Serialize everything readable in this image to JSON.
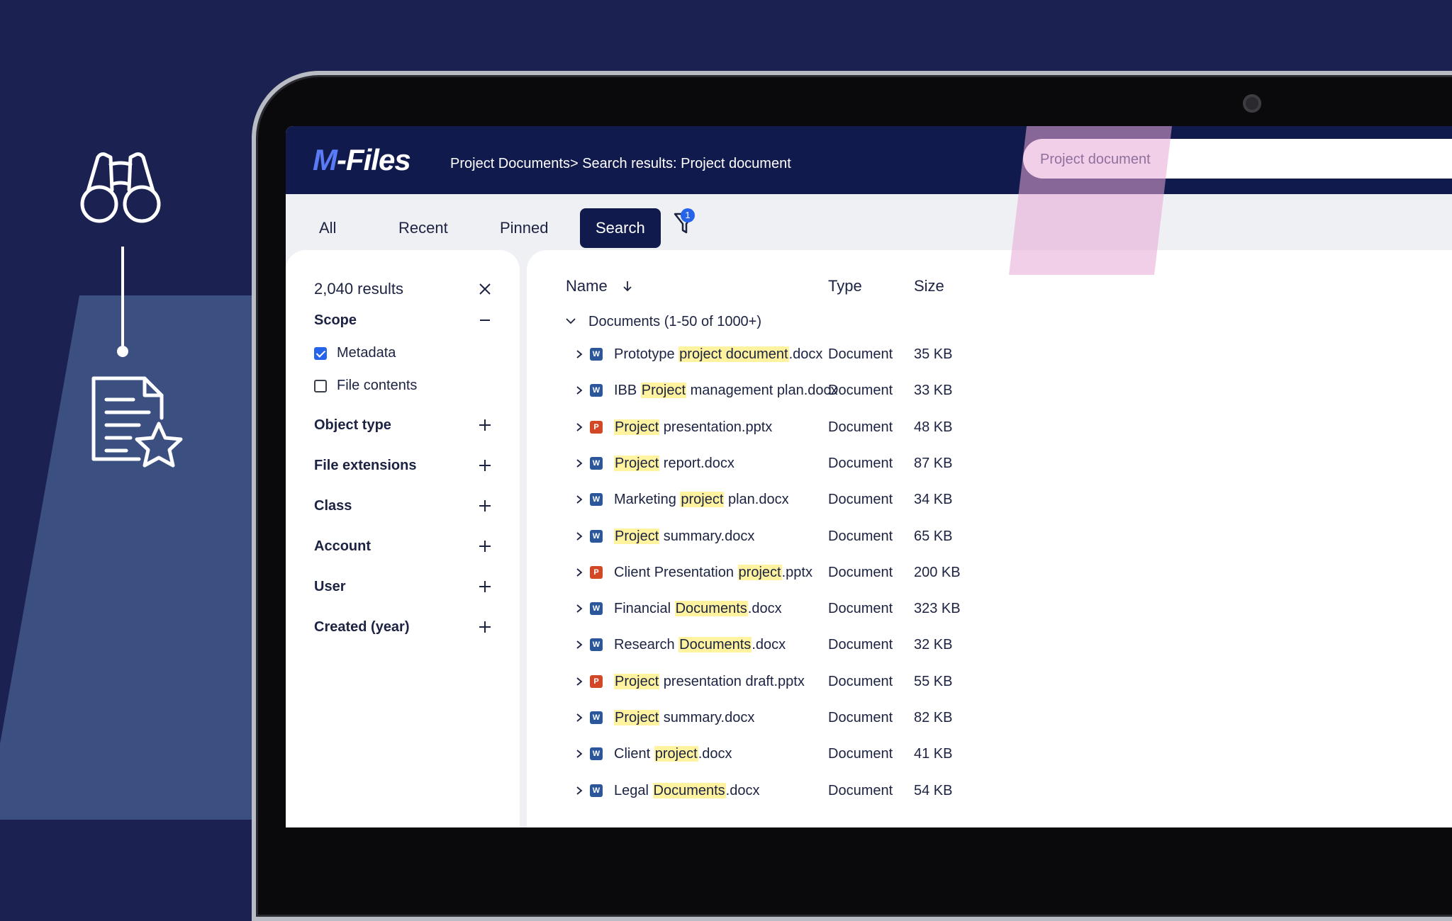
{
  "app": {
    "logo_m": "M",
    "logo_rest": "-Files",
    "breadcrumb": "Project Documents> Search results: Project document",
    "search_value": "Project document"
  },
  "tabs": [
    {
      "label": "All",
      "active": false
    },
    {
      "label": "Recent",
      "active": false
    },
    {
      "label": "Pinned",
      "active": false
    },
    {
      "label": "Search",
      "active": true
    }
  ],
  "filter_badge": "1",
  "filters": {
    "results_count": "2,040 results",
    "scope_label": "Scope",
    "scope_options": [
      {
        "label": "Metadata",
        "checked": true
      },
      {
        "label": "File contents",
        "checked": false
      }
    ],
    "sections": [
      "Object type",
      "File extensions",
      "Class",
      "Account",
      "User",
      "Created (year)"
    ]
  },
  "table": {
    "headers": {
      "name": "Name",
      "type": "Type",
      "size": "Size"
    },
    "group_label": "Documents (1-50 of 1000+)",
    "rows": [
      {
        "pre": "Prototype ",
        "hl": "project document",
        "post": ".docx",
        "type": "Document",
        "size": "35 KB",
        "icon": "word-icon"
      },
      {
        "pre": "IBB ",
        "hl": "Project",
        "post": " management plan.docx",
        "type": "Document",
        "size": "33 KB",
        "icon": "word-icon"
      },
      {
        "pre": "",
        "hl": "Project",
        "post": " presentation.pptx",
        "type": "Document",
        "size": "48 KB",
        "icon": "powerpoint-icon"
      },
      {
        "pre": "",
        "hl": "Project",
        "post": " report.docx",
        "type": "Document",
        "size": "87 KB",
        "icon": "word-icon"
      },
      {
        "pre": "Marketing ",
        "hl": "project",
        "post": " plan.docx",
        "type": "Document",
        "size": "34 KB",
        "icon": "word-icon"
      },
      {
        "pre": "",
        "hl": "Project",
        "post": " summary.docx",
        "type": "Document",
        "size": "65 KB",
        "icon": "word-icon"
      },
      {
        "pre": "Client Presentation ",
        "hl": "project",
        "post": ".pptx",
        "type": "Document",
        "size": "200 KB",
        "icon": "powerpoint-icon"
      },
      {
        "pre": "Financial ",
        "hl": "Documents",
        "post": ".docx",
        "type": "Document",
        "size": "323 KB",
        "icon": "word-icon"
      },
      {
        "pre": "Research ",
        "hl": "Documents",
        "post": ".docx",
        "type": "Document",
        "size": "32 KB",
        "icon": "word-icon"
      },
      {
        "pre": "",
        "hl": "Project",
        "post": " presentation draft.pptx",
        "type": "Document",
        "size": "55 KB",
        "icon": "powerpoint-icon"
      },
      {
        "pre": "",
        "hl": "Project",
        "post": " summary.docx",
        "type": "Document",
        "size": "82 KB",
        "icon": "word-icon"
      },
      {
        "pre": "Client ",
        "hl": "project",
        "post": ".docx",
        "type": "Document",
        "size": "41 KB",
        "icon": "word-icon"
      },
      {
        "pre": "Legal ",
        "hl": "Documents",
        "post": ".docx",
        "type": "Document",
        "size": "54 KB",
        "icon": "word-icon"
      }
    ]
  },
  "icon_letters": {
    "word-icon": "W",
    "powerpoint-icon": "P"
  },
  "decor_icons": [
    "binoculars-icon",
    "document-star-icon"
  ],
  "colors": {
    "background": "#1b2150",
    "topbar": "#111a4c",
    "accent": "#2563eb",
    "highlight": "#fff3a0"
  }
}
